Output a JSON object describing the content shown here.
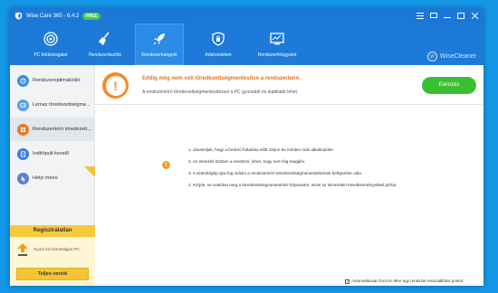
{
  "window": {
    "title": "Wise Care 365 - 6.4.2",
    "badge": "FREE"
  },
  "toolbar": {
    "items": [
      {
        "label": "PC felülvizsgálat",
        "icon": "target-icon"
      },
      {
        "label": "Rendszertisztító",
        "icon": "broom-icon"
      },
      {
        "label": "Rendszerhangoló",
        "icon": "rocket-icon"
      },
      {
        "label": "Adatvédelem",
        "icon": "shield-icon"
      },
      {
        "label": "Rendszerfelügyelet",
        "icon": "monitor-icon"
      }
    ],
    "brand": "WiseCleaner"
  },
  "sidebar": {
    "items": [
      {
        "label": "Rendszeroptimalizáló",
        "color": "#3b8fe0"
      },
      {
        "label": "Lemez töredezettségme...",
        "color": "#5a9ee8"
      },
      {
        "label": "Rendszerleíró töredezett...",
        "color": "#e07b2a"
      },
      {
        "label": "Indítópult kezelő",
        "color": "#3b7be0"
      },
      {
        "label": "Helyi menü",
        "color": "#5a7fd8"
      }
    ]
  },
  "promo": {
    "title": "Regisztrálatlan",
    "text": "Gyors és biztonságos PC",
    "button": "Teljes verzió"
  },
  "header": {
    "title": "Eddig még nem volt töredezettségmentesítve a rendszerleíró.",
    "subtitle": "A rendszerleíró töredezettségmentesítéssel a PC gyorsabb és stabilabb lehet.",
    "scan_button": "Elemzés"
  },
  "steps": [
    "1. Javasoljuk, hogy a funkció futtatása előtt zárjon be minden más alkalmazást.",
    "2. Az elemzés közben a rendszer, lehet, hogy nem fog reagálni.",
    "3. A számítógép újra fog indulni a rendszerleíró töredezettségmentesítésének befejezése után.",
    "4. Kérjük, ne szakítsa meg a töredezettségmentesítési folyamatot, mivel az ismeretlen következményekkel járhat."
  ],
  "footer": {
    "checkbox_label": "Automatikusan hozzon létre egy rendszer-visszaállítási pontot.",
    "checked": true
  },
  "colors": {
    "accent": "#1d7ad9",
    "warning": "#f28c28",
    "scan_button": "#3bbf32"
  }
}
